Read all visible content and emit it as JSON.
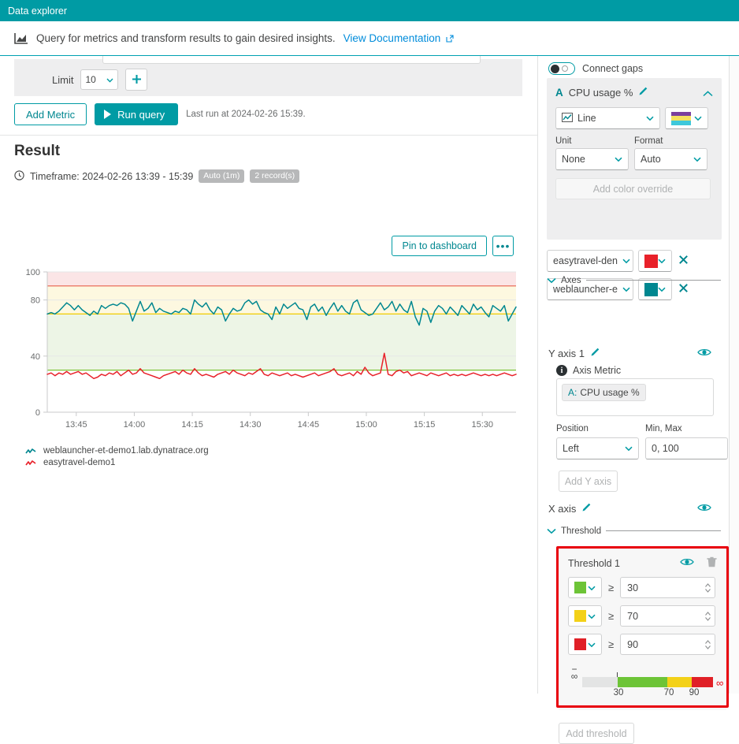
{
  "window": {
    "title": "Data explorer"
  },
  "info": {
    "text": "Query for metrics and transform results to gain desired insights.",
    "link_label": "View Documentation",
    "icon": "chart-icon",
    "external_icon": "external-link-icon"
  },
  "query": {
    "limit_label": "Limit",
    "limit_value": "10",
    "add_metric_label": "Add Metric",
    "run_query_label": "Run query",
    "last_run": "Last run at 2024-02-26 15:39.",
    "add_icon": "plus-icon"
  },
  "result": {
    "title": "Result",
    "clock_icon": "clock-icon",
    "timeframe": "Timeframe: 2024-02-26 13:39 - 15:39",
    "badge_auto": "Auto (1m)",
    "badge_records": "2 record(s)",
    "pin_label": "Pin to dashboard",
    "more_label": "•••"
  },
  "chart_data": {
    "type": "line",
    "title": "",
    "xlabel": "",
    "ylabel": "",
    "ylim": [
      0,
      100
    ],
    "yticks": [
      0,
      40,
      80,
      100
    ],
    "xticks": [
      "13:45",
      "14:00",
      "14:15",
      "14:30",
      "14:45",
      "15:00",
      "15:15",
      "15:30"
    ],
    "grid": true,
    "legend_position": "bottom-left",
    "bands": [
      {
        "from": 0,
        "to": 30,
        "color": "#ffffff"
      },
      {
        "from": 30,
        "to": 70,
        "color": "#edf5e6"
      },
      {
        "from": 70,
        "to": 90,
        "color": "#fdf8e0"
      },
      {
        "from": 90,
        "to": 100,
        "color": "#fbe5e6"
      }
    ],
    "threshold_lines": [
      {
        "value": 30,
        "color": "#7dc334"
      },
      {
        "value": 70,
        "color": "#f0cb00"
      },
      {
        "value": 90,
        "color": "#e8604c"
      }
    ],
    "series": [
      {
        "name": "weblauncher-et-demo1.lab.dynatrace.org",
        "color": "#008790",
        "values": [
          70,
          71,
          70,
          72,
          75,
          78,
          76,
          73,
          76,
          73,
          71,
          69,
          72,
          70,
          76,
          74,
          76,
          77,
          76,
          78,
          77,
          74,
          65,
          72,
          79,
          72,
          74,
          78,
          71,
          74,
          72,
          71,
          70,
          72,
          71,
          74,
          73,
          70,
          80,
          77,
          75,
          78,
          73,
          70,
          75,
          73,
          65,
          70,
          74,
          72,
          73,
          78,
          80,
          77,
          79,
          73,
          71,
          70,
          66,
          75,
          70,
          77,
          74,
          76,
          78,
          74,
          73,
          66,
          75,
          77,
          72,
          75,
          69,
          74,
          78,
          72,
          76,
          72,
          70,
          78,
          80,
          73,
          71,
          69,
          70,
          74,
          78,
          73,
          75,
          79,
          72,
          77,
          73,
          71,
          79,
          68,
          62,
          74,
          72,
          64,
          72,
          76,
          74,
          70,
          75,
          72,
          69,
          76,
          73,
          70,
          77,
          73,
          75,
          71,
          68,
          76,
          74,
          72,
          76,
          65,
          70,
          75
        ]
      },
      {
        "name": "easytravel-demo1",
        "color": "#e8212a",
        "values": [
          27,
          28,
          26,
          28,
          27,
          29,
          27,
          28,
          29,
          27,
          28,
          26,
          24,
          25,
          27,
          26,
          28,
          27,
          29,
          26,
          28,
          30,
          27,
          28,
          31,
          28,
          27,
          26,
          25,
          24,
          26,
          27,
          28,
          29,
          27,
          30,
          28,
          27,
          31,
          28,
          26,
          27,
          26,
          25,
          27,
          28,
          29,
          27,
          30,
          28,
          27,
          26,
          28,
          27,
          29,
          31,
          27,
          26,
          28,
          27,
          26,
          27,
          28,
          26,
          27,
          26,
          25,
          26,
          27,
          28,
          26,
          27,
          28,
          29,
          31,
          27,
          26,
          27,
          28,
          26,
          29,
          27,
          32,
          28,
          26,
          27,
          28,
          42,
          27,
          26,
          29,
          30,
          28,
          29,
          26,
          27,
          28,
          27,
          26,
          28,
          27,
          26,
          27,
          28,
          26,
          27,
          26,
          27,
          26,
          27,
          28,
          27,
          26,
          27,
          26,
          27,
          26,
          27,
          28,
          27,
          26,
          27
        ]
      }
    ]
  },
  "sidebar": {
    "connect_gaps": {
      "label": "Connect gaps",
      "enabled": true
    },
    "metric": {
      "letter": "A",
      "name": "CPU usage %",
      "edit_icon": "pencil-icon",
      "collapse_icon": "chevron-up-icon",
      "visualization": "Line",
      "viz_icon": "line-chart-icon",
      "palette_colors": [
        "#7b3f9e",
        "#f5e05e",
        "#3ec8db"
      ],
      "unit_label": "Unit",
      "unit_value": "None",
      "format_label": "Format",
      "format_value": "Auto",
      "color_override_label": "Add color override",
      "series_overrides": [
        {
          "name": "easytravel-den",
          "color": "#e8212a",
          "remove_icon": "close-icon"
        },
        {
          "name": "weblauncher-e",
          "color": "#008790",
          "remove_icon": "close-icon"
        }
      ]
    },
    "axes": {
      "section_label": "Axes",
      "y_axis_label": "Y axis 1",
      "y_axis_edit_icon": "pencil-icon",
      "y_axis_visibility_icon": "eye-icon",
      "axis_metric_label": "Axis Metric",
      "info_icon": "info-icon",
      "axis_metric_chip": "A: CPU usage %",
      "axis_metric_chip_prefix": "A:",
      "axis_metric_chip_name": "CPU usage %",
      "position_label": "Position",
      "position_value": "Left",
      "minmax_label": "Min, Max",
      "minmax_value": "0, 100",
      "add_y_axis_label": "Add Y axis",
      "x_axis_label": "X axis",
      "x_axis_edit_icon": "pencil-icon",
      "x_axis_visibility_icon": "eye-icon"
    },
    "threshold": {
      "section_label": "Threshold",
      "card_title": "Threshold 1",
      "visibility_icon": "eye-icon",
      "delete_icon": "trash-icon",
      "rows": [
        {
          "color": "#6dc437",
          "operator": "≥",
          "value": "30"
        },
        {
          "color": "#f3d118",
          "operator": "≥",
          "value": "70"
        },
        {
          "color": "#e02027",
          "operator": "≥",
          "value": "90"
        }
      ],
      "scale": {
        "min_symbol": "-∞",
        "max_symbol": "∞",
        "ticks": [
          "30",
          "70",
          "90"
        ],
        "segment_colors": [
          "#e3e4e4",
          "#6dc437",
          "#f3d118",
          "#e02027"
        ]
      },
      "add_threshold_label": "Add threshold"
    }
  },
  "colors": {
    "accent": "#009ba4",
    "link": "#008cdb",
    "highlight_outline": "#e8000d"
  }
}
